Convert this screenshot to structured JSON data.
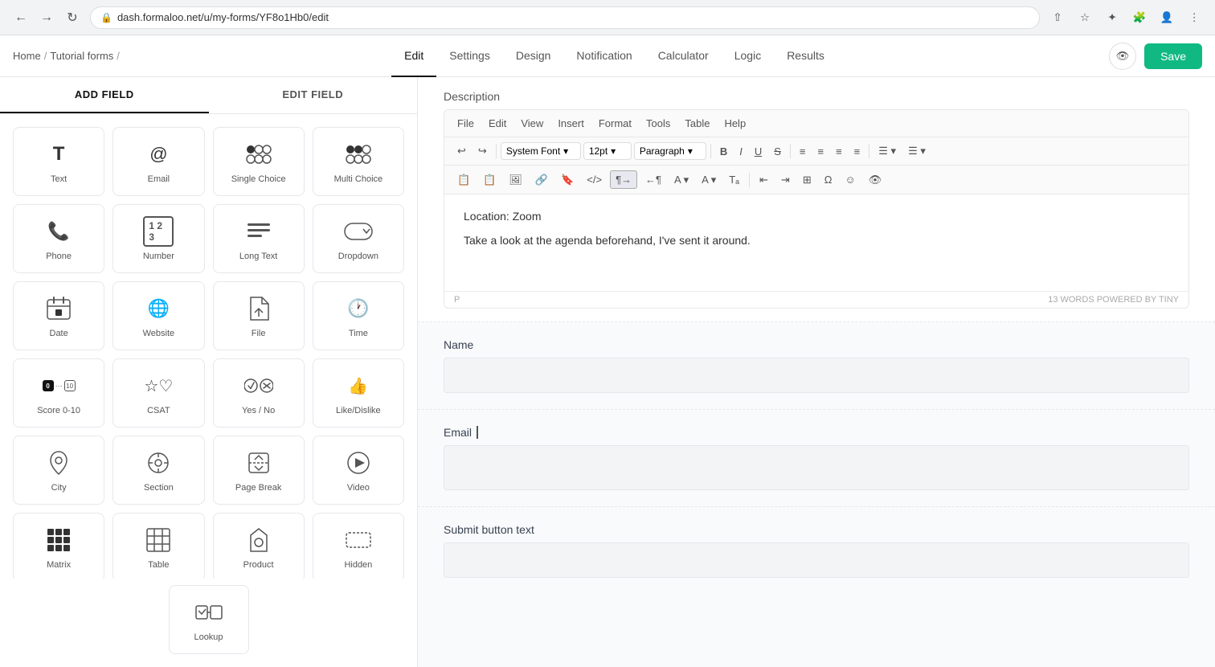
{
  "browser": {
    "url": "dash.formaloo.net/u/my-forms/YF8o1Hb0/edit",
    "back": "‹",
    "forward": "›",
    "refresh": "↺"
  },
  "header": {
    "breadcrumb": [
      "Home",
      "Tutorial forms"
    ],
    "tabs": [
      "Edit",
      "Settings",
      "Design",
      "Notification",
      "Calculator",
      "Logic",
      "Results"
    ],
    "active_tab": "Edit",
    "save_label": "Save"
  },
  "left_panel": {
    "tabs": [
      "ADD FIELD",
      "EDIT FIELD"
    ],
    "active_tab": "ADD FIELD",
    "fields": [
      {
        "id": "text",
        "label": "Text",
        "icon": "T"
      },
      {
        "id": "email",
        "label": "Email",
        "icon": "@"
      },
      {
        "id": "single-choice",
        "label": "Single Choice",
        "icon": "radio"
      },
      {
        "id": "multi-choice",
        "label": "Multi Choice",
        "icon": "multi-radio"
      },
      {
        "id": "phone",
        "label": "Phone",
        "icon": "phone"
      },
      {
        "id": "number",
        "label": "Number",
        "icon": "123"
      },
      {
        "id": "long-text",
        "label": "Long Text",
        "icon": "lines"
      },
      {
        "id": "dropdown",
        "label": "Dropdown",
        "icon": "dropdown"
      },
      {
        "id": "date",
        "label": "Date",
        "icon": "calendar"
      },
      {
        "id": "website",
        "label": "Website",
        "icon": "globe"
      },
      {
        "id": "file",
        "label": "File",
        "icon": "upload"
      },
      {
        "id": "time",
        "label": "Time",
        "icon": "clock"
      },
      {
        "id": "score",
        "label": "Score 0-10",
        "icon": "score"
      },
      {
        "id": "csat",
        "label": "CSAT",
        "icon": "csat"
      },
      {
        "id": "yes-no",
        "label": "Yes / No",
        "icon": "yesno"
      },
      {
        "id": "like-dislike",
        "label": "Like/Dislike",
        "icon": "like"
      },
      {
        "id": "city",
        "label": "City",
        "icon": "pin"
      },
      {
        "id": "section",
        "label": "Section",
        "icon": "section"
      },
      {
        "id": "page-break",
        "label": "Page Break",
        "icon": "pagebreak"
      },
      {
        "id": "video",
        "label": "Video",
        "icon": "play"
      },
      {
        "id": "matrix",
        "label": "Matrix",
        "icon": "matrix"
      },
      {
        "id": "table",
        "label": "Table",
        "icon": "table"
      },
      {
        "id": "product",
        "label": "Product",
        "icon": "product"
      },
      {
        "id": "hidden",
        "label": "Hidden",
        "icon": "hidden"
      }
    ],
    "lookup": {
      "label": "Lookup",
      "icon": "lookup"
    }
  },
  "editor": {
    "menu_items": [
      "File",
      "Edit",
      "View",
      "Insert",
      "Format",
      "Tools",
      "Table",
      "Help"
    ],
    "font": "System Font",
    "size": "12pt",
    "style": "Paragraph",
    "content_lines": [
      "Location: Zoom",
      "Take a look at the agenda beforehand, I've sent it around."
    ],
    "status_left": "P",
    "status_right": "13 WORDS   POWERED BY TINY"
  },
  "form": {
    "description_label": "Description",
    "fields": [
      {
        "label": "Name",
        "type": "text",
        "value": ""
      },
      {
        "label": "Email",
        "type": "email",
        "value": ""
      },
      {
        "label": "Submit button text",
        "type": "text",
        "value": ""
      }
    ]
  }
}
